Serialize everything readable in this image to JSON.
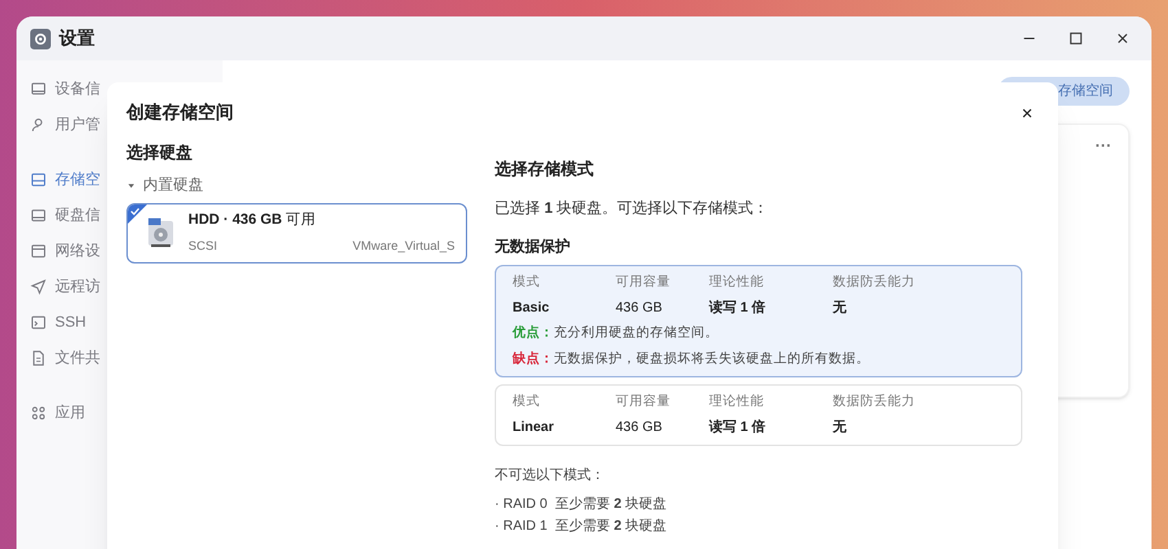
{
  "window": {
    "title": "设置"
  },
  "sidebar": {
    "items": [
      {
        "label": "设备信",
        "selected": false
      },
      {
        "label": "用户管",
        "selected": false
      },
      {
        "label": "存储空",
        "selected": true
      },
      {
        "label": "硬盘信",
        "selected": false
      },
      {
        "label": "网络设",
        "selected": false
      },
      {
        "label": "远程访",
        "selected": false
      },
      {
        "label": "SSH",
        "selected": false
      },
      {
        "label": "文件共",
        "selected": false
      },
      {
        "label": "应用",
        "selected": false
      }
    ]
  },
  "background": {
    "create_button": "存储空间",
    "card_menu": "···"
  },
  "dialog": {
    "title": "创建存储空间",
    "disk_section": {
      "title": "选择硬盘",
      "group": {
        "label": "内置硬盘",
        "expanded": true
      },
      "disks": [
        {
          "title": "**HDD · 436 GB** 可用",
          "interface": "SCSI",
          "model": "VMware_Virtual_S",
          "selected": true
        }
      ]
    },
    "mode_section": {
      "title": "选择存储模式",
      "summary": "已选择 **1** 块硬盘。可选择以下存储模式：",
      "group_title": "无数据保护",
      "modes": [
        {
          "selected": true,
          "columns": [
            {
              "label": "模式",
              "value": "Basic"
            },
            {
              "label": "可用容量",
              "value": "436 GB"
            },
            {
              "label": "理论性能",
              "value": "读写 1 倍"
            },
            {
              "label": "数据防丢能力",
              "value": "无"
            }
          ],
          "pros": {
            "label": "优点：",
            "text": "充分利用硬盘的存储空间。"
          },
          "cons": {
            "label": "缺点：",
            "text": "无数据保护，硬盘损坏将丢失该硬盘上的所有数据。"
          }
        },
        {
          "selected": false,
          "columns": [
            {
              "label": "模式",
              "value": "Linear"
            },
            {
              "label": "可用容量",
              "value": "436 GB"
            },
            {
              "label": "理论性能",
              "value": "读写 1 倍"
            },
            {
              "label": "数据防丢能力",
              "value": "无"
            }
          ]
        }
      ],
      "unavailable_title": "不可选以下模式：",
      "unavailable": [
        "· RAID 0  至少需要 **2** 块硬盘",
        "· RAID 1  至少需要 **2** 块硬盘"
      ]
    }
  }
}
